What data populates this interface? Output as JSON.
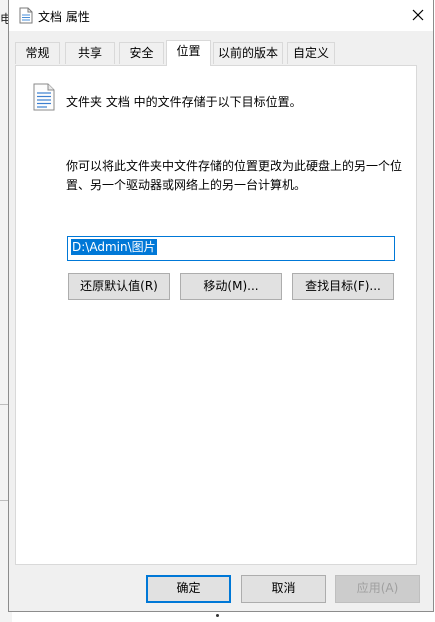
{
  "background_window": {
    "edge_char": "电"
  },
  "dialog": {
    "title": "文档 属性",
    "tabs": [
      {
        "label": "常规"
      },
      {
        "label": "共享"
      },
      {
        "label": "安全"
      },
      {
        "label": "位置",
        "active": true
      },
      {
        "label": "以前的版本"
      },
      {
        "label": "自定义"
      }
    ],
    "location": {
      "description": "文件夹 文档 中的文件存储于以下目标位置。",
      "explanation": "你可以将此文件夹中文件存储的位置更改为此硬盘上的另一个位置、另一个驱动器或网络上的另一台计算机。",
      "path_value": "D:\\Admin\\图片",
      "restore_default_label": "还原默认值(R)",
      "move_label": "移动(M)...",
      "find_target_label": "查找目标(F)..."
    },
    "footer": {
      "ok_label": "确定",
      "cancel_label": "取消",
      "apply_label": "应用(A)"
    }
  },
  "colors": {
    "accent": "#0078d7",
    "dialog_bg": "#f0f0f0",
    "panel_bg": "#ffffff",
    "button_bg": "#e1e1e1"
  },
  "icons": [
    "document-icon",
    "folder-doc-icon",
    "close-icon"
  ]
}
